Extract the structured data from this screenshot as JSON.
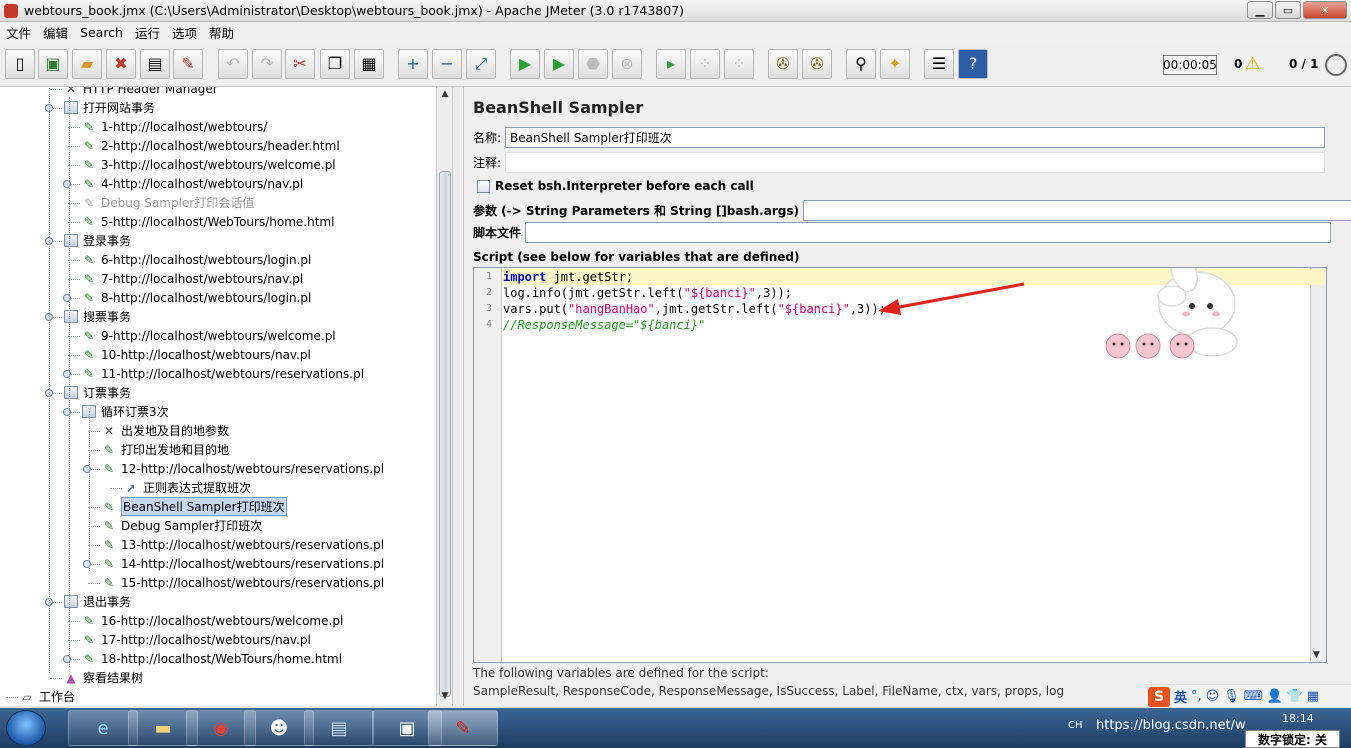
{
  "window": {
    "title": "webtours_book.jmx (C:\\Users\\Administrator\\Desktop\\webtours_book.jmx) - Apache JMeter (3.0 r1743807)"
  },
  "menu": [
    "文件",
    "编辑",
    "Search",
    "运行",
    "选项",
    "帮助"
  ],
  "toolbar": {
    "timer": "00:00:05",
    "error_count": "0",
    "threads": "0 / 1",
    "icons": [
      "new-icon",
      "templates-icon",
      "open-icon",
      "close-icon",
      "save-icon",
      "save-as-icon",
      "undo-icon",
      "redo-icon",
      "cut-icon",
      "copy-icon",
      "paste-icon",
      "expand-icon",
      "collapse-icon",
      "toggle-icon",
      "start-icon",
      "start-no-timers-icon",
      "stop-icon",
      "shutdown-icon",
      "remote-start-icon",
      "remote-stop-icon",
      "remote-shutdown-icon",
      "clear-icon",
      "clear-all-icon",
      "search-icon",
      "reset-search-icon",
      "function-helper-icon",
      "help-icon"
    ]
  },
  "tree": [
    {
      "label": "HTTP Header Manager",
      "type": "tool",
      "level": 3
    },
    {
      "label": "打开网站事务",
      "type": "txn",
      "level": 3
    },
    {
      "label": "1-http://localhost/webtours/",
      "type": "sampler",
      "level": 4
    },
    {
      "label": "2-http://localhost/webtours/header.html",
      "type": "sampler",
      "level": 4
    },
    {
      "label": "3-http://localhost/webtours/welcome.pl",
      "type": "sampler",
      "level": 4
    },
    {
      "label": "4-http://localhost/webtours/nav.pl",
      "type": "sampler",
      "level": 4
    },
    {
      "label": "Debug Sampler打印会话值",
      "type": "sampler-disabled",
      "level": 4
    },
    {
      "label": "5-http://localhost/WebTours/home.html",
      "type": "sampler",
      "level": 4
    },
    {
      "label": "登录事务",
      "type": "txn",
      "level": 3
    },
    {
      "label": "6-http://localhost/webtours/login.pl",
      "type": "sampler",
      "level": 4
    },
    {
      "label": "7-http://localhost/webtours/nav.pl",
      "type": "sampler",
      "level": 4
    },
    {
      "label": "8-http://localhost/webtours/login.pl",
      "type": "sampler",
      "level": 4
    },
    {
      "label": "搜票事务",
      "type": "txn",
      "level": 3
    },
    {
      "label": "9-http://localhost/webtours/welcome.pl",
      "type": "sampler",
      "level": 4
    },
    {
      "label": "10-http://localhost/webtours/nav.pl",
      "type": "sampler",
      "level": 4
    },
    {
      "label": "11-http://localhost/webtours/reservations.pl",
      "type": "sampler",
      "level": 4
    },
    {
      "label": "订票事务",
      "type": "txn",
      "level": 3
    },
    {
      "label": "循环订票3次",
      "type": "txn",
      "level": 4
    },
    {
      "label": "出发地及目的地参数",
      "type": "tool",
      "level": 5
    },
    {
      "label": "打印出发地和目的地",
      "type": "sampler",
      "level": 5
    },
    {
      "label": "12-http://localhost/webtours/reservations.pl",
      "type": "sampler",
      "level": 5
    },
    {
      "label": "正则表达式提取班次",
      "type": "regex",
      "level": 6
    },
    {
      "label": "BeanShell Sampler打印班次",
      "type": "sampler",
      "level": 5,
      "selected": true
    },
    {
      "label": "Debug Sampler打印班次",
      "type": "sampler",
      "level": 5
    },
    {
      "label": "13-http://localhost/webtours/reservations.pl",
      "type": "sampler",
      "level": 5
    },
    {
      "label": "14-http://localhost/webtours/reservations.pl",
      "type": "sampler",
      "level": 5
    },
    {
      "label": "15-http://localhost/webtours/reservations.pl",
      "type": "sampler",
      "level": 5
    },
    {
      "label": "退出事务",
      "type": "txn",
      "level": 3
    },
    {
      "label": "16-http://localhost/webtours/welcome.pl",
      "type": "sampler",
      "level": 4
    },
    {
      "label": "17-http://localhost/webtours/nav.pl",
      "type": "sampler",
      "level": 4
    },
    {
      "label": "18-http://localhost/WebTours/home.html",
      "type": "sampler",
      "level": 4
    },
    {
      "label": "察看结果树",
      "type": "listener",
      "level": 3
    },
    {
      "label": "工作台",
      "type": "workbench",
      "level": 1
    }
  ],
  "panel": {
    "title": "BeanShell Sampler",
    "name_label": "名称:",
    "name_value": "BeanShell Sampler打印班次",
    "comment_label": "注释:",
    "comment_value": "",
    "reset_label": "Reset bsh.Interpreter before each call",
    "params_label": "参数 (-> String Parameters 和 String []bash.args)",
    "params_value": "",
    "script_file_label": "脚本文件",
    "script_file_value": "",
    "script_label": "Script (see below for variables that are defined)",
    "code_lines": [
      {
        "no": "1",
        "parts": [
          {
            "t": "import",
            "c": "kw"
          },
          {
            "t": " jmt.getStr;",
            "c": ""
          }
        ]
      },
      {
        "no": "2",
        "parts": [
          {
            "t": "log.info(jmt.getStr.left(",
            "c": ""
          },
          {
            "t": "\"${banci}\"",
            "c": "str"
          },
          {
            "t": ",3));",
            "c": ""
          }
        ]
      },
      {
        "no": "3",
        "parts": [
          {
            "t": "vars.put(",
            "c": ""
          },
          {
            "t": "\"hangBanHao\"",
            "c": "str"
          },
          {
            "t": ",jmt.getStr.left(",
            "c": ""
          },
          {
            "t": "\"${banci}\"",
            "c": "str"
          },
          {
            "t": ",3));",
            "c": ""
          }
        ]
      },
      {
        "no": "4",
        "parts": [
          {
            "t": "//ResponseMessage=\"${banci}\"",
            "c": "cmt"
          }
        ]
      }
    ],
    "vars_info": "The following variables are defined for the script:",
    "vars_list": "SampleResult, ResponseCode, ResponseMessage, IsSuccess, Label, FileName, ctx, vars, props, log"
  },
  "ime": {
    "logo": "S",
    "mode": "英"
  },
  "taskbar": {
    "lang": "CH",
    "tray_text": "https://blog.csdn.net/w",
    "time": "18:14",
    "numlock": "数字锁定: 关"
  },
  "colors": {
    "accent_red": "#e0241a",
    "selection": "#c6d8f0",
    "highlight_line": "#fbf6c6"
  }
}
